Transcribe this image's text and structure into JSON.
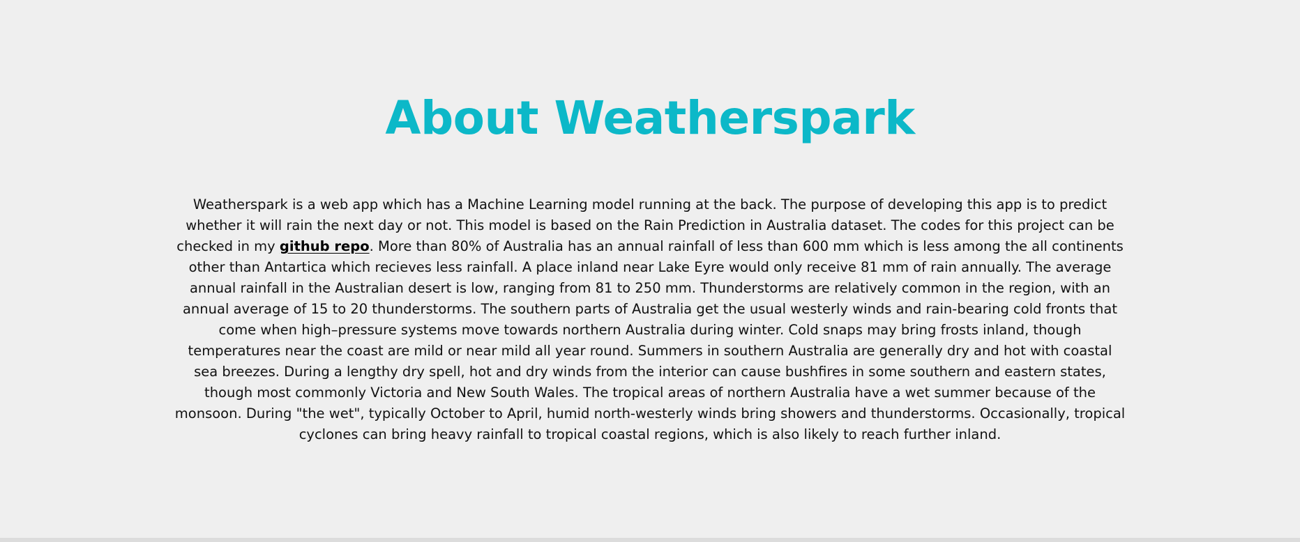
{
  "about": {
    "title": "About Weatherspark",
    "paragraph_before_link": "Weatherspark is a web app which has a Machine Learning model running at the back. The purpose of developing this app is to predict whether it will rain the next day or not. This model is based on the Rain Prediction in Australia dataset. The codes for this project can be checked in my ",
    "link_text": "github repo",
    "paragraph_after_link": ". More than 80% of Australia has an annual rainfall of less than 600 mm which is less among the all continents other than Antartica which recieves less rainfall. A place inland near Lake Eyre would only receive 81 mm of rain annually. The average annual rainfall in the Australian desert is low, ranging from 81 to 250 mm. Thunderstorms are relatively common in the region, with an annual average of 15 to 20 thunderstorms. The southern parts of Australia get the usual westerly winds and rain-bearing cold fronts that come when high–pressure systems move towards northern Australia during winter. Cold snaps may bring frosts inland, though temperatures near the coast are mild or near mild all year round. Summers in southern Australia are generally dry and hot with coastal sea breezes. During a lengthy dry spell, hot and dry winds from the interior can cause bushfires in some southern and eastern states, though most commonly Victoria and New South Wales. The tropical areas of northern Australia have a wet summer because of the monsoon. During \"the wet\", typically October to April, humid north-westerly winds bring showers and thunderstorms. Occasionally, tropical cyclones can bring heavy rainfall to tropical coastal regions, which is also likely to reach further inland."
  },
  "colors": {
    "title": "#0cb8c8",
    "background": "#efefef",
    "text": "#111111"
  }
}
